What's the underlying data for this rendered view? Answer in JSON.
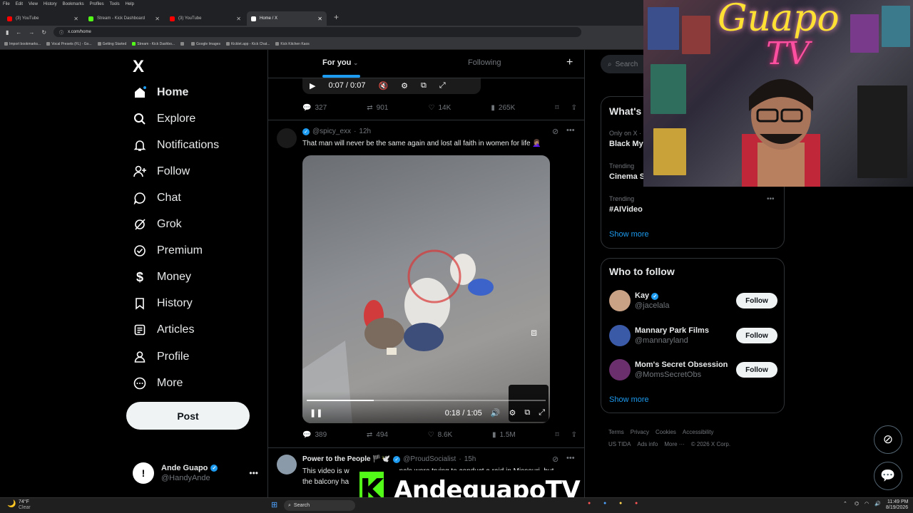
{
  "browser": {
    "menu": [
      "File",
      "Edit",
      "View",
      "History",
      "Bookmarks",
      "Profiles",
      "Tools",
      "Help"
    ],
    "tabs": [
      {
        "label": "(3) YouTube",
        "color": "#ff0000"
      },
      {
        "label": "Stream - Kick Dashboard",
        "color": "#53fc18"
      },
      {
        "label": "(3) YouTube",
        "color": "#ff0000"
      },
      {
        "label": "Home / X",
        "color": "#ffffff"
      }
    ],
    "url": "x.com/home",
    "bookmarks": [
      "Import bookmarks...",
      "Vocal Presets (FL) - Go...",
      "Getting Started",
      "Stream - Kick Dashbo...",
      "Google Images",
      "Kicklet.app - Kick Chat...",
      "Kick Kitchen Kaos"
    ]
  },
  "nav": {
    "logo": "X",
    "items": [
      {
        "label": "Home",
        "icon": "⌂"
      },
      {
        "label": "Explore",
        "icon": "⌕"
      },
      {
        "label": "Notifications",
        "icon": "🔔"
      },
      {
        "label": "Follow",
        "icon": "👤"
      },
      {
        "label": "Chat",
        "icon": "💬"
      },
      {
        "label": "Grok",
        "icon": "⊘"
      },
      {
        "label": "Premium",
        "icon": "✓"
      },
      {
        "label": "Money",
        "icon": "$"
      },
      {
        "label": "History",
        "icon": "🔖"
      },
      {
        "label": "Articles",
        "icon": "☰"
      },
      {
        "label": "Profile",
        "icon": "👤"
      },
      {
        "label": "More",
        "icon": "⋯"
      }
    ],
    "post": "Post",
    "account": {
      "name": "Ande Guapo",
      "handle": "@HandyAnde"
    }
  },
  "timeline": {
    "tabs": {
      "for_you": "For you",
      "following": "Following",
      "plus": "+"
    },
    "prev_video_time": "0:07 / 0:07",
    "prev_actions": {
      "replies": "327",
      "reposts": "901",
      "likes": "14K",
      "views": "265K"
    },
    "tweet": {
      "handle": "@spicy_exx",
      "time": "12h",
      "text": "That man will never be the same again and lost all faith in women for life 🤦🏽‍♀️",
      "video_time": "0:18 / 1:05",
      "progress": 0.28,
      "actions": {
        "replies": "389",
        "reposts": "494",
        "likes": "8.6K",
        "views": "1.5M"
      }
    },
    "next_tweet": {
      "name": "Power to the People 🏴🕊️",
      "handle": "@ProudSocialist",
      "time": "15h",
      "text_line1": "This video is w",
      "text_line1b": "nals were trying to conduct a raid in Missouri, but",
      "text_line2": "the balcony ha"
    }
  },
  "right": {
    "search_placeholder": "Search",
    "whats_happening": "What's",
    "trends": [
      {
        "context": "Only on X ·",
        "title": "Black My"
      },
      {
        "context": "Trending",
        "title": "Cinema S"
      },
      {
        "context": "Trending",
        "title": "#AIVideo"
      }
    ],
    "show_more": "Show more",
    "who_to_follow": "Who to follow",
    "suggestions": [
      {
        "name": "Kay",
        "handle": "@jacelala",
        "verified": true,
        "button": "Follow"
      },
      {
        "name": "Mannary Park Films",
        "handle": "@mannaryland",
        "verified": false,
        "button": "Follow"
      },
      {
        "name": "Mom's Secret Obsession",
        "handle": "@MomsSecretObs",
        "verified": false,
        "button": "Follow"
      }
    ],
    "footer": [
      "Terms",
      "Privacy",
      "Cookies",
      "Accessibility",
      "US TIDA",
      "Ads info",
      "More ···",
      "© 2026 X Corp."
    ]
  },
  "overlay": {
    "cam_title_line1": "Guapo",
    "cam_title_line2": "TV",
    "kick_logo": "K",
    "kick_name": "AndeguapoTV"
  },
  "taskbar": {
    "weather_temp": "74°F",
    "weather_desc": "Clear",
    "search": "Search",
    "time": "11:49 PM",
    "date": "8/19/2026"
  },
  "colors": {
    "accent": "#1d9bf0",
    "kick_green": "#53fc18",
    "bg": "#000000"
  }
}
